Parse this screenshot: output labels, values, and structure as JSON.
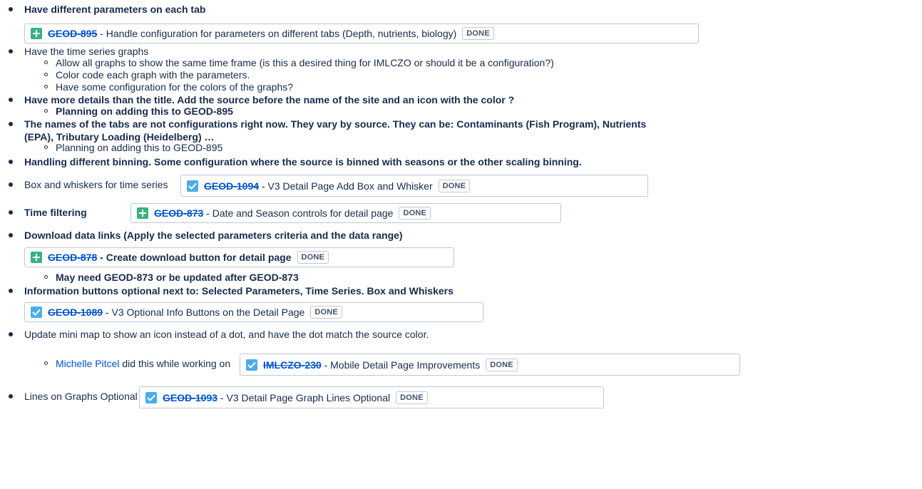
{
  "items": [
    {
      "text": "Have different parameters on each tab"
    },
    {
      "text": "Have the time series graphs"
    },
    {
      "text": "Allow all graphs to show the same time frame (is this a desired thing for IMLCZO or should it be a configuration?)"
    },
    {
      "text": "Color code each graph with the parameters."
    },
    {
      "text": "Have some configuration for the colors of the graphs?"
    },
    {
      "text": "Have more details than the title. Add the source before the name of the site and an icon with the color ?"
    },
    {
      "text": "Planning on adding this to GEOD-895"
    },
    {
      "line1": "The names of the tabs are not configurations right now. They vary by source. They can be: Contaminants (Fish Program), Nutrients",
      "line2": "(EPA), Tributary Loading (Heidelberg) …"
    },
    {
      "text": "Planning on adding this to GEOD-895"
    },
    {
      "text": "Handling different binning. Some configuration where the source is binned with seasons or the other scaling binning."
    },
    {
      "text": "Box and whiskers for time series"
    },
    {
      "text": "Time filtering"
    },
    {
      "text": "Download data links (Apply the selected parameters criteria and the data range)"
    },
    {
      "text": "May need GEOD-873 or be updated after GEOD-873"
    },
    {
      "text": "Information buttons optional next to: Selected Parameters, Time Series. Box and Whiskers"
    },
    {
      "text": "Update mini map to show an icon instead of a dot, and have the dot match the source color."
    },
    {
      "user": "Michelle Pitcel",
      "text": " did this while working on"
    },
    {
      "text": "Lines on Graphs Optional"
    }
  ],
  "issues": [
    {
      "key": "GEOD-895",
      "sep": " - ",
      "summary": "Handle configuration for parameters on different tabs (Depth, nutrients, biology)",
      "status": "DONE",
      "type_icon": "story-plus-icon"
    },
    {
      "key": "GEOD-1094",
      "sep": " - ",
      "summary": "V3 Detail Page Add Box and Whisker",
      "status": "DONE",
      "type_icon": "task-check-icon"
    },
    {
      "key": "GEOD-873",
      "sep": " - ",
      "summary": "Date and Season controls for detail page",
      "status": "DONE",
      "type_icon": "story-plus-icon"
    },
    {
      "key": "GEOD-878",
      "sep": " - ",
      "summary": "Create download button for detail page",
      "status": "DONE",
      "type_icon": "story-plus-icon"
    },
    {
      "key": "GEOD-1089",
      "sep": " - ",
      "summary": "V3 Optional Info Buttons on the Detail Page",
      "status": "DONE",
      "type_icon": "task-check-icon"
    },
    {
      "key": "IMLCZO-230",
      "sep": " - ",
      "summary": "Mobile Detail Page Improvements",
      "status": "DONE",
      "type_icon": "task-check-icon"
    },
    {
      "key": "GEOD-1093",
      "sep": " - ",
      "summary": "V3 Detail Page Graph Lines Optional",
      "status": "DONE",
      "type_icon": "task-check-icon"
    }
  ],
  "colors": {
    "text": "#172b4d",
    "link": "#0052cc",
    "story": "#36b37e",
    "task": "#4bade8",
    "border": "#c1c7d0"
  }
}
